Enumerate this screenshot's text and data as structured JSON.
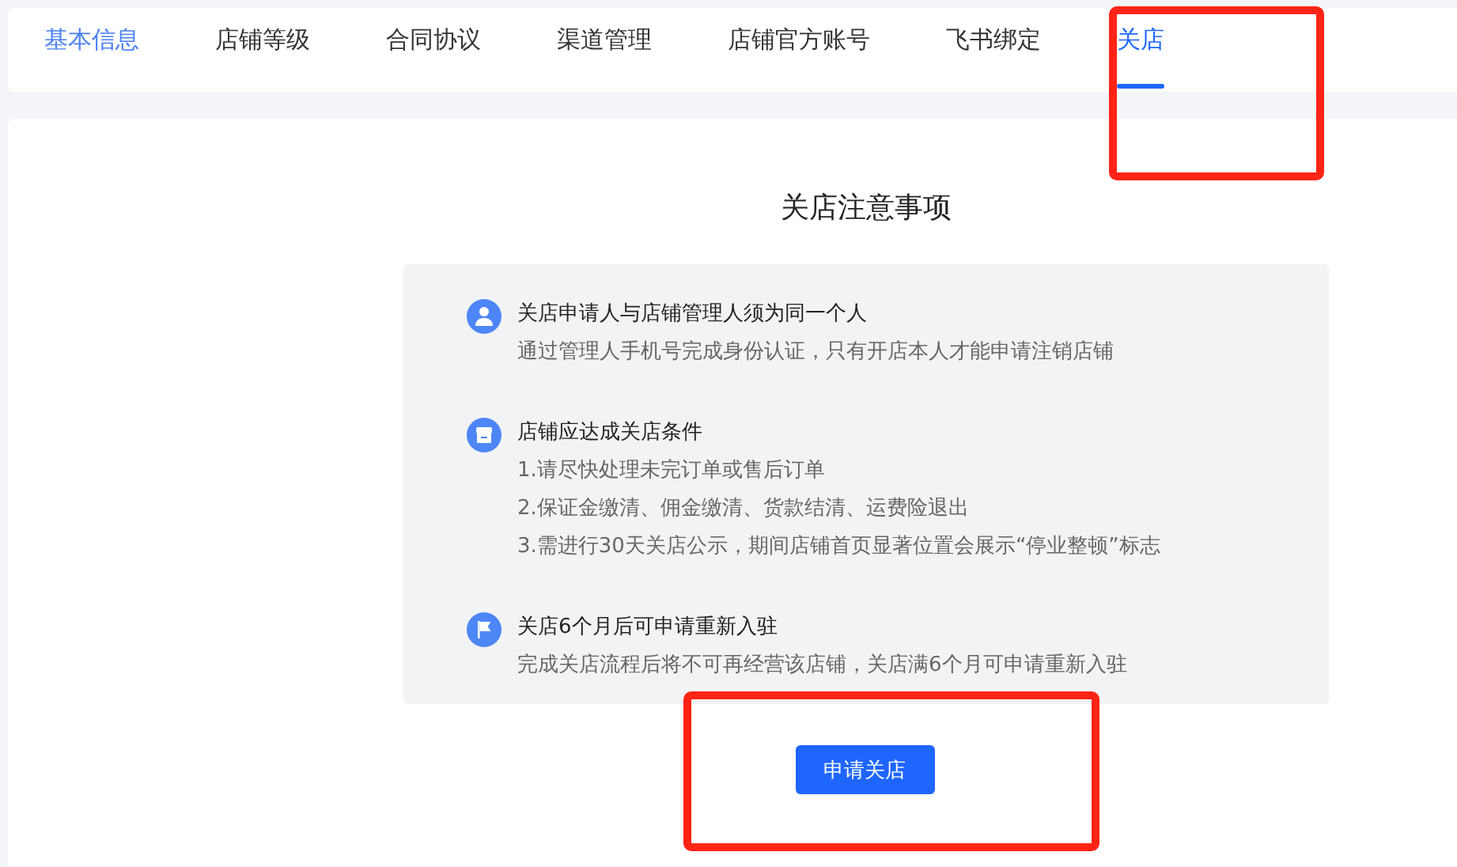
{
  "tabs": [
    {
      "label": "基本信息",
      "selected": false,
      "hovered": true,
      "highlighted": false
    },
    {
      "label": "店铺等级",
      "selected": false,
      "hovered": false,
      "highlighted": false
    },
    {
      "label": "合同协议",
      "selected": false,
      "hovered": false,
      "highlighted": false
    },
    {
      "label": "渠道管理",
      "selected": false,
      "hovered": false,
      "highlighted": false
    },
    {
      "label": "店铺官方账号",
      "selected": false,
      "hovered": false,
      "highlighted": false
    },
    {
      "label": "飞书绑定",
      "selected": false,
      "hovered": false,
      "highlighted": false
    },
    {
      "label": "关店",
      "selected": true,
      "hovered": false,
      "highlighted": true
    }
  ],
  "title": "关店注意事项",
  "notices": [
    {
      "kind": "person",
      "heading": "关店申请人与店铺管理人须为同一个人",
      "lines": [
        "通过管理人手机号完成身份认证，只有开店本人才能申请注销店铺"
      ]
    },
    {
      "kind": "store",
      "heading": "店铺应达成关店条件",
      "lines": [
        "1.请尽快处理未完订单或售后订单",
        "2.保证金缴清、佣金缴清、货款结清、运费险退出",
        "3.需进行30天关店公示，期间店铺首页显著位置会展示“停业整顿”标志"
      ]
    },
    {
      "kind": "flag",
      "heading": "关店6个月后可申请重新入驻",
      "lines": [
        "完成关店流程后将不可再经营该店铺，关店满6个月可申请重新入驻"
      ]
    }
  ],
  "button": {
    "label": "申请关店",
    "highlighted": true
  }
}
